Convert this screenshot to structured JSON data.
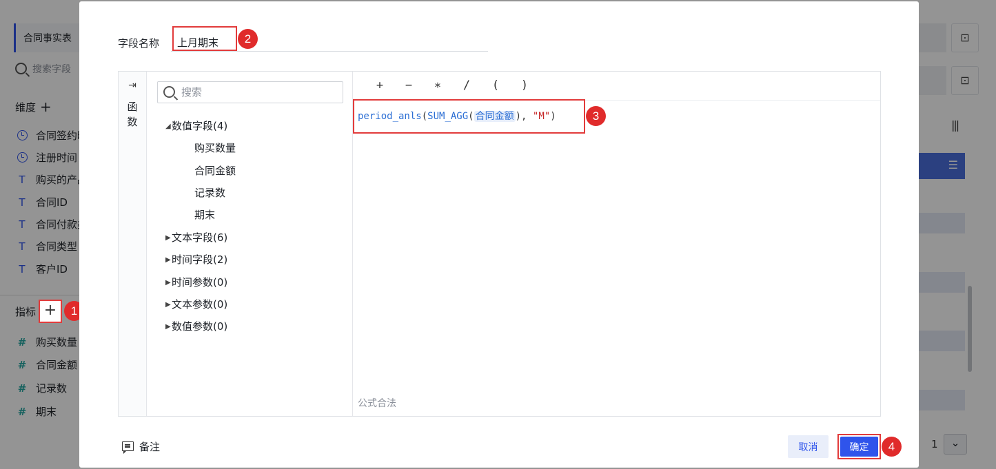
{
  "background": {
    "table_tab": "合同事实表",
    "search_placeholder": "搜索字段",
    "dimensions_label": "维度",
    "dimensions": [
      {
        "icon": "clock-icon",
        "label": "合同签约时间"
      },
      {
        "icon": "clock-icon",
        "label": "注册时间"
      },
      {
        "icon": "text-icon",
        "label": "购买的产品"
      },
      {
        "icon": "text-icon",
        "label": "合同ID"
      },
      {
        "icon": "text-icon",
        "label": "合同付款类型"
      },
      {
        "icon": "text-icon",
        "label": "合同类型"
      },
      {
        "icon": "text-icon",
        "label": "客户ID"
      }
    ],
    "metrics_label": "指标",
    "metrics": [
      {
        "icon": "hash-icon",
        "label": "购买数量"
      },
      {
        "icon": "hash-icon",
        "label": "合同金额"
      },
      {
        "icon": "hash-plus-icon",
        "label": "记录数"
      },
      {
        "icon": "hash-plus-icon",
        "label": "期末"
      }
    ],
    "pager_value": "1"
  },
  "dialog": {
    "field_name_label": "字段名称",
    "field_name_value": "上月期末",
    "functions_tab": "函数",
    "search_placeholder": "搜索",
    "tree": [
      {
        "label": "数值字段(4)",
        "expanded": true,
        "children": [
          "购买数量",
          "合同金额",
          "记录数",
          "期末"
        ]
      },
      {
        "label": "文本字段(6)",
        "expanded": false
      },
      {
        "label": "时间字段(2)",
        "expanded": false
      },
      {
        "label": "时间参数(0)",
        "expanded": false
      },
      {
        "label": "文本参数(0)",
        "expanded": false
      },
      {
        "label": "数值参数(0)",
        "expanded": false
      }
    ],
    "operators": [
      "+",
      "−",
      "∗",
      "/",
      "(",
      ")"
    ],
    "formula": {
      "fn_name": "period_anls",
      "open_paren": "(",
      "agg_name": "SUM_AGG",
      "agg_open": "(",
      "field": "合同金额",
      "agg_close": ")",
      "comma": ", ",
      "string_arg": "\"M\"",
      "close_paren": ")"
    },
    "formula_status": "公式合法",
    "note_label": "备注",
    "cancel_label": "取消",
    "ok_label": "确定"
  },
  "callouts": [
    "1",
    "2",
    "3",
    "4"
  ],
  "colors": {
    "accent": "#2f54eb",
    "callout": "#e02b2b",
    "highlight_border": "#e23b3b"
  }
}
